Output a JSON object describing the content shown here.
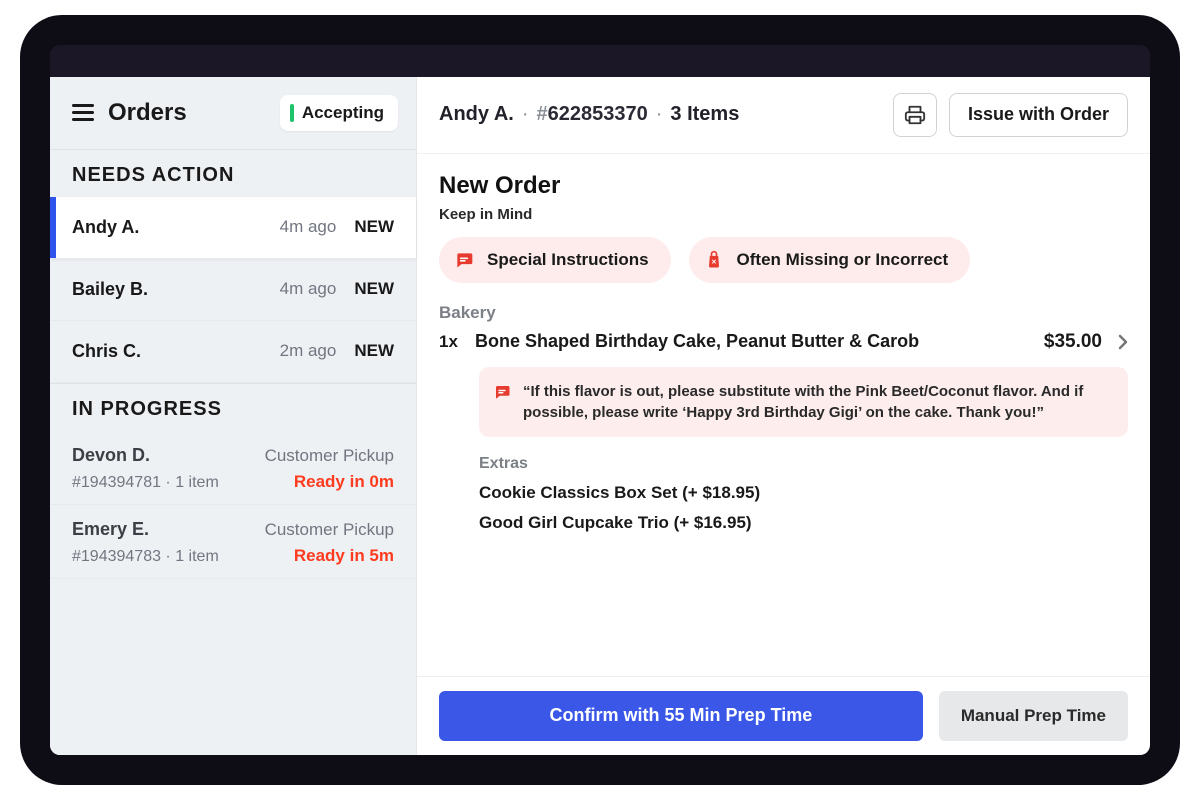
{
  "sidebar": {
    "title": "Orders",
    "accepting_label": "Accepting"
  },
  "sections": {
    "needs_action_label": "NEEDS  ACTION",
    "in_progress_label": "IN PROGRESS"
  },
  "needs_action": [
    {
      "name": "Andy A.",
      "time": "4m ago",
      "badge": "NEW",
      "selected": true
    },
    {
      "name": "Bailey B.",
      "time": "4m ago",
      "badge": "NEW",
      "selected": false
    },
    {
      "name": "Chris C.",
      "time": "2m ago",
      "badge": "NEW",
      "selected": false
    }
  ],
  "in_progress": [
    {
      "name": "Devon D.",
      "type": "Customer Pickup",
      "meta": "#194394781 · 1 item",
      "ready": "Ready in 0m"
    },
    {
      "name": "Emery E.",
      "type": "Customer Pickup",
      "meta": "#194394783 · 1 item",
      "ready": "Ready in 5m"
    }
  ],
  "header": {
    "customer": "Andy A.",
    "sep": " · ",
    "hash": "#",
    "order_id": "622853370",
    "items": "3 Items",
    "issue_label": "Issue with Order"
  },
  "order": {
    "title": "New Order",
    "keep_label": "Keep in Mind",
    "chip_special": "Special Instructions",
    "chip_missing": "Often Missing or Incorrect",
    "category": "Bakery",
    "line": {
      "qty": "1x",
      "name": "Bone Shaped Birthday Cake, Peanut Butter & Carob",
      "price": "$35.00"
    },
    "note": "“If this flavor is out, please substitute with the Pink Beet/Coconut flavor. And if possible, please write ‘Happy 3rd Birthday Gigi’ on the cake. Thank you!”",
    "extras_label": "Extras",
    "extras": [
      "Cookie Classics Box Set  (+ $18.95)",
      "Good Girl Cupcake Trio  (+ $16.95)"
    ]
  },
  "footer": {
    "confirm": "Confirm with 55 Min Prep Time",
    "manual": "Manual Prep Time"
  }
}
